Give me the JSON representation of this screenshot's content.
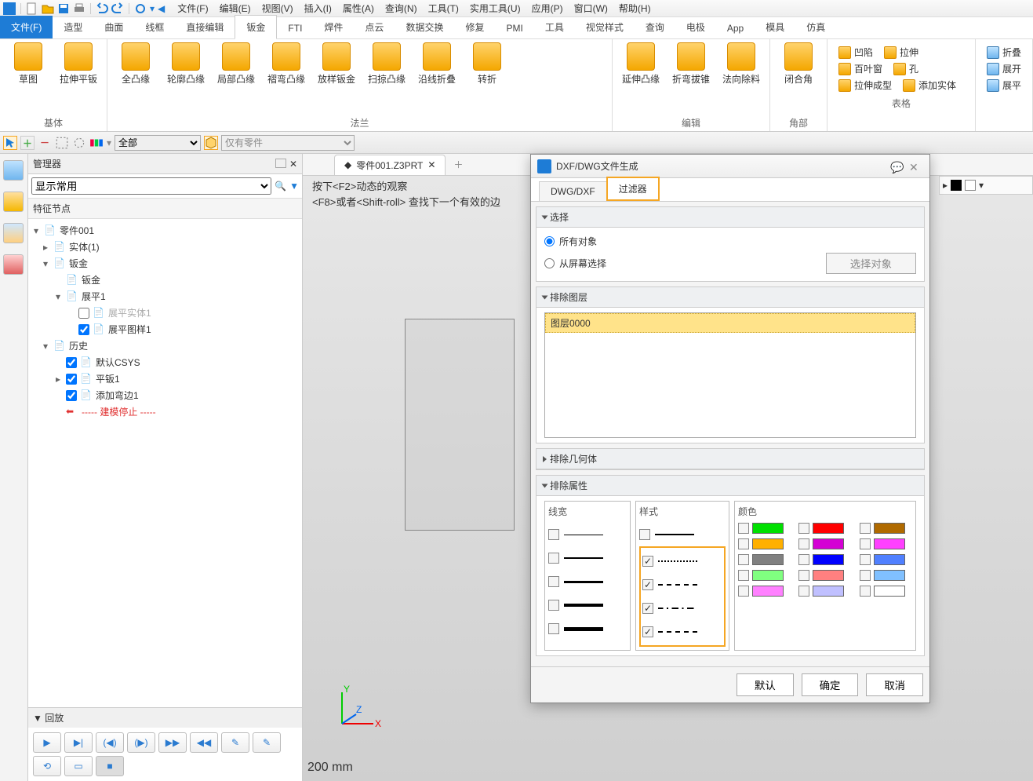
{
  "menus": [
    "文件(F)",
    "编辑(E)",
    "视图(V)",
    "插入(I)",
    "属性(A)",
    "查询(N)",
    "工具(T)",
    "实用工具(U)",
    "应用(P)",
    "窗口(W)",
    "帮助(H)"
  ],
  "ribbon_tabs": [
    "文件(F)",
    "造型",
    "曲面",
    "线框",
    "直接编辑",
    "钣金",
    "FTI",
    "焊件",
    "点云",
    "数据交换",
    "修复",
    "PMI",
    "工具",
    "视觉样式",
    "查询",
    "电极",
    "App",
    "模具",
    "仿真"
  ],
  "ribbon_active": "钣金",
  "ribbon_groups": {
    "base": {
      "label": "基体",
      "buttons": [
        "草图",
        "拉伸平钣"
      ]
    },
    "flange": {
      "label": "法兰",
      "buttons": [
        "全凸缘",
        "轮廓凸缘",
        "局部凸缘",
        "褶弯凸缘",
        "放样钣金",
        "扫掠凸缘",
        "沿线折叠",
        "转折"
      ]
    },
    "edit": {
      "label": "编辑",
      "buttons": [
        "延伸凸缘",
        "折弯拔锥",
        "法向除料"
      ]
    },
    "corner": {
      "label": "角部",
      "buttons": [
        "闭合角"
      ]
    },
    "form": {
      "label": "表格",
      "rows": [
        [
          "凹陷",
          "拉伸"
        ],
        [
          "百叶窗",
          "孔"
        ],
        [
          "拉伸成型",
          "添加实体"
        ]
      ]
    },
    "extra": {
      "rows": [
        "折叠",
        "展开",
        "展平"
      ]
    }
  },
  "toolbar2": {
    "dropdown": "全部",
    "filter": "仅有零件"
  },
  "manager": {
    "title": "管理器",
    "display": "显示常用",
    "tree_header": "特征节点",
    "playback": "回放"
  },
  "tree": [
    {
      "ind": 0,
      "exp": "▾",
      "ico": "part",
      "txt": "零件001"
    },
    {
      "ind": 1,
      "exp": "▸",
      "ico": "body",
      "txt": "实体(1)"
    },
    {
      "ind": 1,
      "exp": "▾",
      "ico": "sheet",
      "txt": "钣金"
    },
    {
      "ind": 2,
      "exp": "",
      "ico": "sheet",
      "txt": "钣金"
    },
    {
      "ind": 2,
      "exp": "▾",
      "ico": "flat",
      "txt": "展平1"
    },
    {
      "ind": 3,
      "exp": "",
      "chk": false,
      "ico": "flat",
      "txt": "展平实体1",
      "gray": true
    },
    {
      "ind": 3,
      "exp": "",
      "chk": true,
      "ico": "pattern",
      "txt": "展平图样1"
    },
    {
      "ind": 1,
      "exp": "▾",
      "ico": "hist",
      "txt": "历史"
    },
    {
      "ind": 2,
      "exp": "",
      "chk": true,
      "ico": "csys",
      "txt": "默认CSYS"
    },
    {
      "ind": 2,
      "exp": "▸",
      "chk": true,
      "ico": "flat",
      "txt": "平钣1"
    },
    {
      "ind": 2,
      "exp": "",
      "chk": true,
      "ico": "bend",
      "txt": "添加弯边1"
    },
    {
      "ind": 2,
      "exp": "",
      "ico": "stop",
      "txt": "----- 建模停止 -----",
      "red": true
    }
  ],
  "tab": {
    "name": "零件001.Z3PRT"
  },
  "hints": [
    "按下<F2>动态的观察",
    "<F8>或者<Shift-roll> 查找下一个有效的边"
  ],
  "scale": "200 mm",
  "dialog": {
    "title": "DXF/DWG文件生成",
    "tab1": "DWG/DXF",
    "tab2": "过滤器",
    "sec_select": "选择",
    "opt_all": "所有对象",
    "opt_screen": "从屏幕选择",
    "btn_pick": "选择对象",
    "sec_exclude_layer": "排除图层",
    "layer": "图层0000",
    "sec_exclude_geom": "排除几何体",
    "sec_exclude_attr": "排除属性",
    "attr_width": "线宽",
    "attr_style": "样式",
    "attr_color": "颜色",
    "btn_default": "默认",
    "btn_ok": "确定",
    "btn_cancel": "取消"
  },
  "colors": [
    "#00e000",
    "#ff0000",
    "#b06a00",
    "#ffb000",
    "#d400d4",
    "#ff40ff",
    "#808080",
    "#0000ff",
    "#5080ff",
    "#80ff80",
    "#ff8080",
    "#80c0ff",
    "#ff80ff",
    "#c0c0ff",
    "#ffffff"
  ]
}
